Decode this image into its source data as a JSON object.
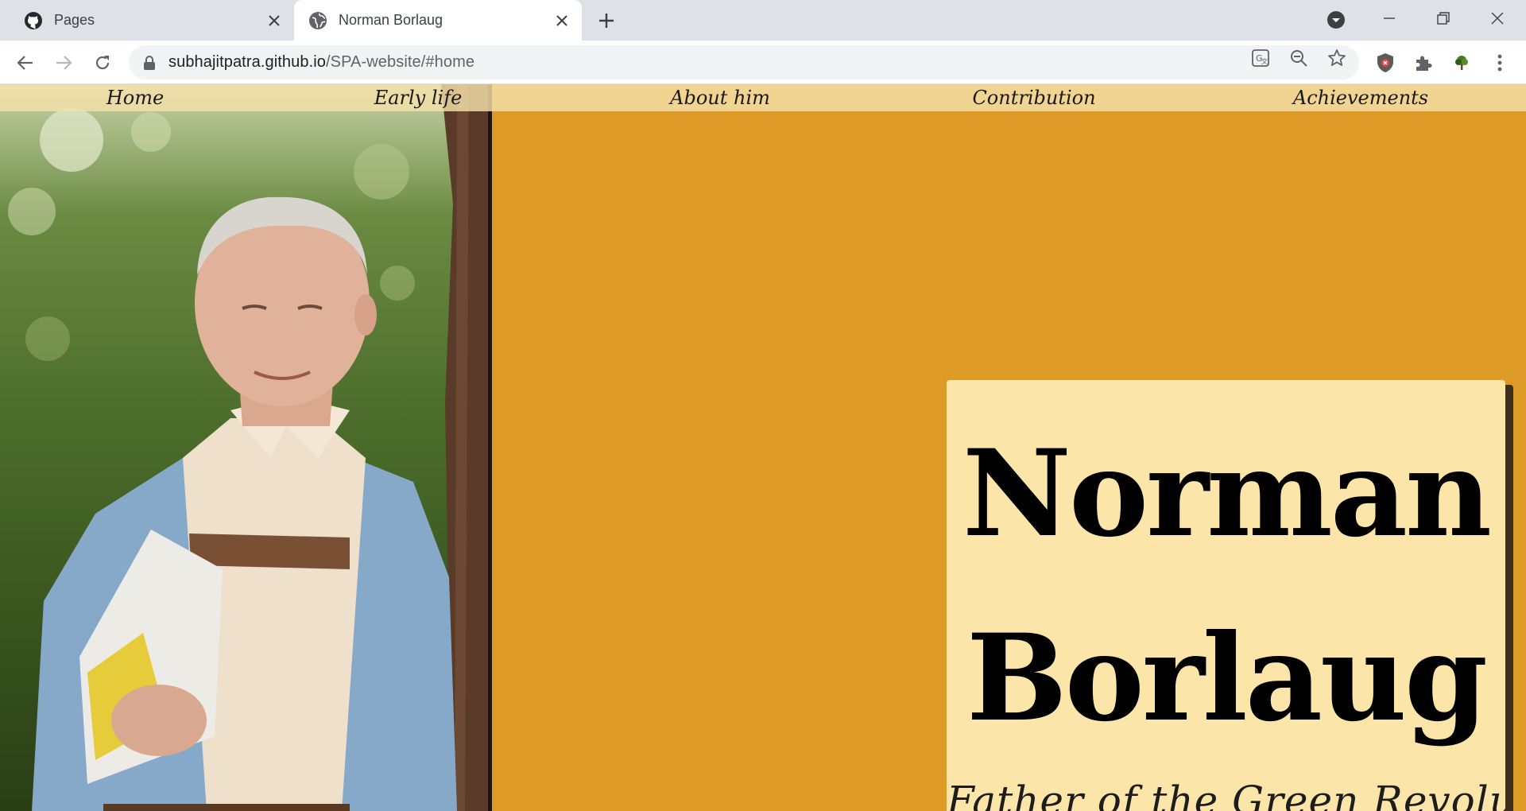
{
  "browser": {
    "tabs": [
      {
        "title": "Pages",
        "favicon": "github-icon",
        "active": false
      },
      {
        "title": "Norman Borlaug",
        "favicon": "globe-icon",
        "active": true
      }
    ],
    "address": {
      "host": "subhajitpatra.github.io",
      "path": "/SPA-website/#home"
    },
    "omnibox_icons": [
      "translate-icon",
      "zoom-out-icon",
      "bookmark-star-icon"
    ],
    "extension_icons": [
      "shield-extension-icon",
      "puzzle-extensions-icon",
      "tree-extension-icon",
      "more-vertical-icon"
    ]
  },
  "site": {
    "nav": [
      "Home",
      "Early life",
      "About him",
      "Contribution",
      "Achievements"
    ],
    "hero": {
      "first_name": "Norman",
      "last_name": "Borlaug",
      "subtitle": "Father of the Green Revolution"
    }
  },
  "colors": {
    "page_background": "#dd9a26",
    "card_background": "#fbe5a8",
    "nav_bar": "#f5e0aa",
    "text": "#000000"
  }
}
